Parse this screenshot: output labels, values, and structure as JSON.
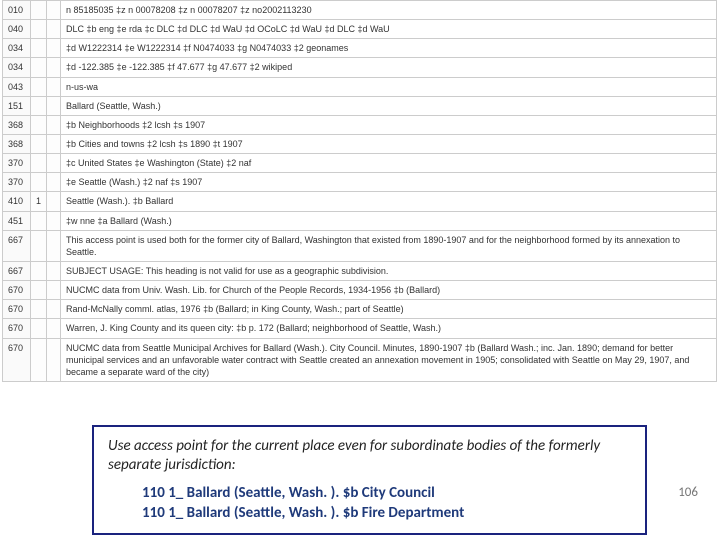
{
  "marc_rows": [
    {
      "tag": "010",
      "i1": "",
      "i2": "",
      "content": "n  85185035 ‡z n  00078208 ‡z n  00078207 ‡z no2002113230"
    },
    {
      "tag": "040",
      "i1": "",
      "i2": "",
      "content": "DLC ‡b eng ‡e rda ‡c DLC ‡d DLC ‡d WaU ‡d OCoLC ‡d WaU ‡d DLC ‡d WaU"
    },
    {
      "tag": "034",
      "i1": "",
      "i2": "",
      "content": "‡d W1222314 ‡e W1222314 ‡f N0474033 ‡g N0474033 ‡2 geonames"
    },
    {
      "tag": "034",
      "i1": "",
      "i2": "",
      "content": "‡d -122.385 ‡e -122.385 ‡f 47.677 ‡g 47.677 ‡2 wikiped"
    },
    {
      "tag": "043",
      "i1": "",
      "i2": "",
      "content": "n-us-wa"
    },
    {
      "tag": "151",
      "i1": "",
      "i2": "",
      "content": "Ballard (Seattle, Wash.)"
    },
    {
      "tag": "368",
      "i1": "",
      "i2": "",
      "content": "‡b Neighborhoods ‡2 lcsh ‡s 1907"
    },
    {
      "tag": "368",
      "i1": "",
      "i2": "",
      "content": "‡b Cities and towns ‡2 lcsh ‡s 1890 ‡t 1907"
    },
    {
      "tag": "370",
      "i1": "",
      "i2": "",
      "content": "‡c United States ‡e Washington (State) ‡2 naf"
    },
    {
      "tag": "370",
      "i1": "",
      "i2": "",
      "content": "‡e Seattle (Wash.) ‡2 naf ‡s 1907"
    },
    {
      "tag": "410",
      "i1": "1",
      "i2": "",
      "content": "Seattle (Wash.). ‡b Ballard"
    },
    {
      "tag": "451",
      "i1": "",
      "i2": "",
      "content": "‡w nne ‡a Ballard (Wash.)"
    },
    {
      "tag": "667",
      "i1": "",
      "i2": "",
      "content": "This access point is used both for the former city of Ballard, Washington that existed from 1890-1907 and for the neighborhood formed by its annexation to Seattle."
    },
    {
      "tag": "667",
      "i1": "",
      "i2": "",
      "content": "SUBJECT USAGE: This heading is not valid for use as a geographic subdivision."
    },
    {
      "tag": "670",
      "i1": "",
      "i2": "",
      "content": "NUCMC data from Univ. Wash. Lib. for Church of the People Records, 1934-1956 ‡b (Ballard)"
    },
    {
      "tag": "670",
      "i1": "",
      "i2": "",
      "content": "Rand-McNally comml. atlas, 1976 ‡b (Ballard; in King County, Wash.; part of Seattle)"
    },
    {
      "tag": "670",
      "i1": "",
      "i2": "",
      "content": "Warren, J. King County and its queen city: ‡b p. 172 (Ballard; neighborhood of Seattle, Wash.)"
    },
    {
      "tag": "670",
      "i1": "",
      "i2": "",
      "content": "NUCMC data from Seattle Municipal Archives for Ballard (Wash.). City Council. Minutes, 1890-1907 ‡b (Ballard Wash.; inc. Jan. 1890; demand for better municipal services and an unfavorable water contract with Seattle created an annexation movement in 1905; consolidated with Seattle on May 29, 1907, and became a separate ward of the city)"
    }
  ],
  "callout": {
    "note": "Use access point for the current place even for subordinate bodies of the formerly separate jurisdiction:",
    "example1": "110 1_ Ballard (Seattle, Wash. ). $b City Council",
    "example2": "110 1_ Ballard (Seattle, Wash. ). $b Fire Department"
  },
  "page_number": "106"
}
